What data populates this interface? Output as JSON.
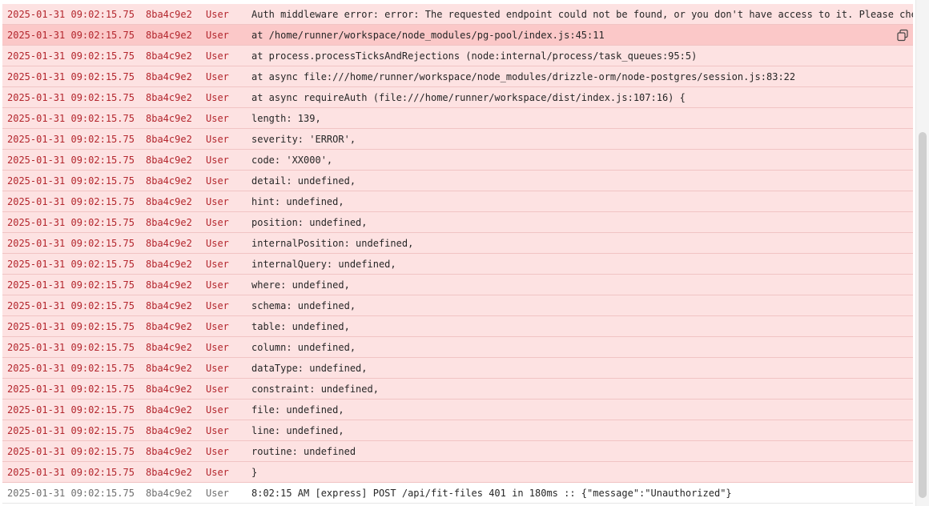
{
  "rows": [
    {
      "ts": "2025-01-31 09:02:15.75",
      "id": "8ba4c9e2",
      "src": "User",
      "msg": "Auth middleware error: error: The requested endpoint could not be found, or you don't have access to it. Please check",
      "level": "err"
    },
    {
      "ts": "2025-01-31 09:02:15.75",
      "id": "8ba4c9e2",
      "src": "User",
      "msg": "at /home/runner/workspace/node_modules/pg-pool/index.js:45:11",
      "level": "err",
      "highlight": true
    },
    {
      "ts": "2025-01-31 09:02:15.75",
      "id": "8ba4c9e2",
      "src": "User",
      "msg": "at process.processTicksAndRejections (node:internal/process/task_queues:95:5)",
      "level": "err"
    },
    {
      "ts": "2025-01-31 09:02:15.75",
      "id": "8ba4c9e2",
      "src": "User",
      "msg": "at async file:///home/runner/workspace/node_modules/drizzle-orm/node-postgres/session.js:83:22",
      "level": "err"
    },
    {
      "ts": "2025-01-31 09:02:15.75",
      "id": "8ba4c9e2",
      "src": "User",
      "msg": "at async requireAuth (file:///home/runner/workspace/dist/index.js:107:16) {",
      "level": "err"
    },
    {
      "ts": "2025-01-31 09:02:15.75",
      "id": "8ba4c9e2",
      "src": "User",
      "msg": "length: 139,",
      "level": "err"
    },
    {
      "ts": "2025-01-31 09:02:15.75",
      "id": "8ba4c9e2",
      "src": "User",
      "msg": "severity: 'ERROR',",
      "level": "err"
    },
    {
      "ts": "2025-01-31 09:02:15.75",
      "id": "8ba4c9e2",
      "src": "User",
      "msg": "code: 'XX000',",
      "level": "err"
    },
    {
      "ts": "2025-01-31 09:02:15.75",
      "id": "8ba4c9e2",
      "src": "User",
      "msg": "detail: undefined,",
      "level": "err"
    },
    {
      "ts": "2025-01-31 09:02:15.75",
      "id": "8ba4c9e2",
      "src": "User",
      "msg": "hint: undefined,",
      "level": "err"
    },
    {
      "ts": "2025-01-31 09:02:15.75",
      "id": "8ba4c9e2",
      "src": "User",
      "msg": "position: undefined,",
      "level": "err"
    },
    {
      "ts": "2025-01-31 09:02:15.75",
      "id": "8ba4c9e2",
      "src": "User",
      "msg": "internalPosition: undefined,",
      "level": "err"
    },
    {
      "ts": "2025-01-31 09:02:15.75",
      "id": "8ba4c9e2",
      "src": "User",
      "msg": "internalQuery: undefined,",
      "level": "err"
    },
    {
      "ts": "2025-01-31 09:02:15.75",
      "id": "8ba4c9e2",
      "src": "User",
      "msg": "where: undefined,",
      "level": "err"
    },
    {
      "ts": "2025-01-31 09:02:15.75",
      "id": "8ba4c9e2",
      "src": "User",
      "msg": "schema: undefined,",
      "level": "err"
    },
    {
      "ts": "2025-01-31 09:02:15.75",
      "id": "8ba4c9e2",
      "src": "User",
      "msg": "table: undefined,",
      "level": "err"
    },
    {
      "ts": "2025-01-31 09:02:15.75",
      "id": "8ba4c9e2",
      "src": "User",
      "msg": "column: undefined,",
      "level": "err"
    },
    {
      "ts": "2025-01-31 09:02:15.75",
      "id": "8ba4c9e2",
      "src": "User",
      "msg": "dataType: undefined,",
      "level": "err"
    },
    {
      "ts": "2025-01-31 09:02:15.75",
      "id": "8ba4c9e2",
      "src": "User",
      "msg": "constraint: undefined,",
      "level": "err"
    },
    {
      "ts": "2025-01-31 09:02:15.75",
      "id": "8ba4c9e2",
      "src": "User",
      "msg": "file: undefined,",
      "level": "err"
    },
    {
      "ts": "2025-01-31 09:02:15.75",
      "id": "8ba4c9e2",
      "src": "User",
      "msg": "line: undefined,",
      "level": "err"
    },
    {
      "ts": "2025-01-31 09:02:15.75",
      "id": "8ba4c9e2",
      "src": "User",
      "msg": "routine: undefined",
      "level": "err"
    },
    {
      "ts": "2025-01-31 09:02:15.75",
      "id": "8ba4c9e2",
      "src": "User",
      "msg": "}",
      "level": "err"
    },
    {
      "ts": "2025-01-31 09:02:15.75",
      "id": "8ba4c9e2",
      "src": "User",
      "msg": "8:02:15 AM [express] POST /api/fit-files 401 in 180ms :: {\"message\":\"Unauthorized\"}",
      "level": "info"
    }
  ],
  "icons": {
    "copy": "copy-icon"
  },
  "colors": {
    "error_bg": "#fde2e2",
    "error_highlight_bg": "#fbc8c8",
    "error_text": "#b3262d",
    "info_text": "#6e6e6e"
  }
}
